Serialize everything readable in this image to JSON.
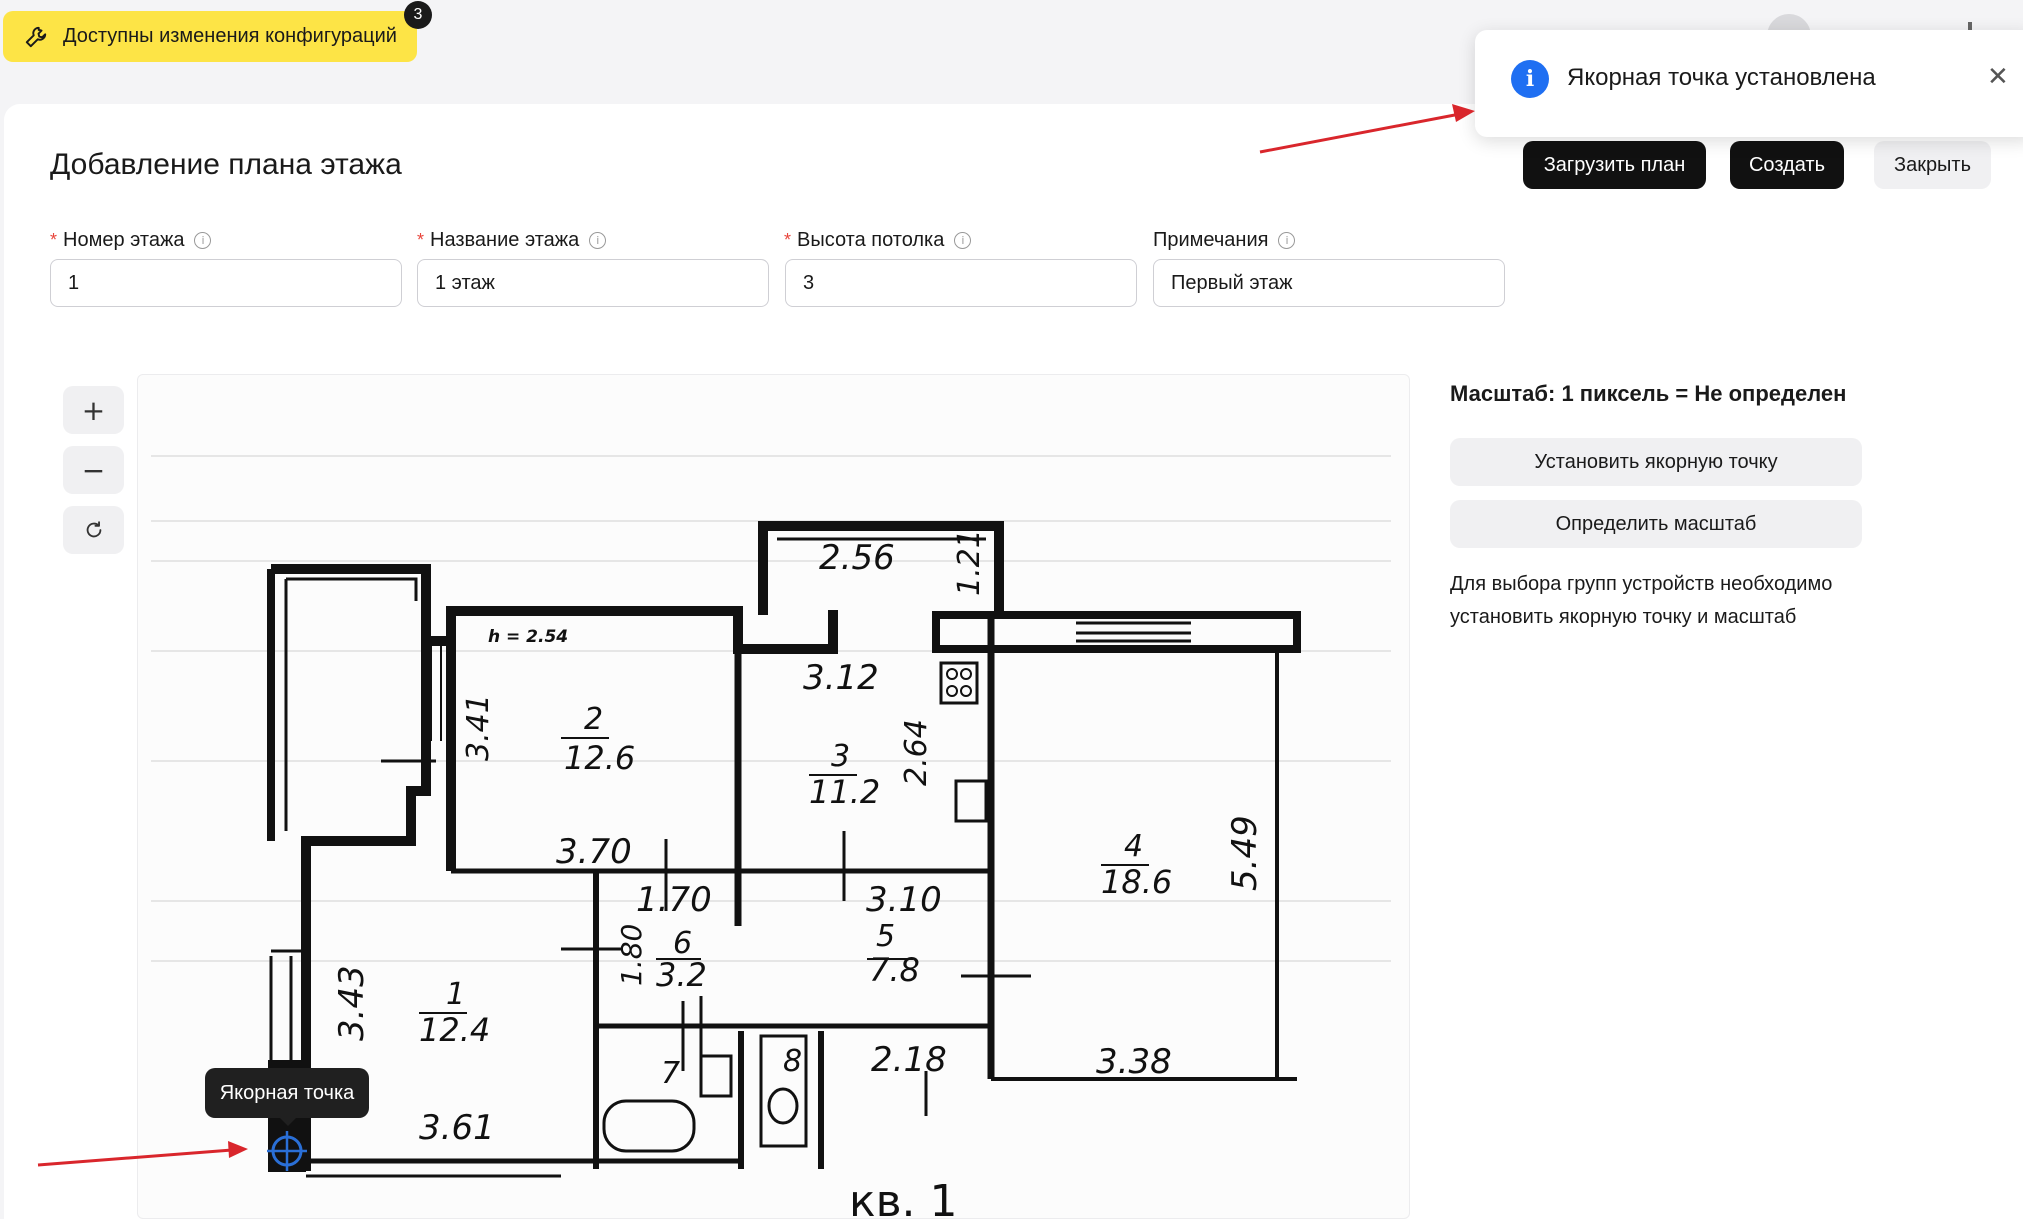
{
  "banner": {
    "label": "Доступны изменения конфигураций",
    "badge_count": "3",
    "icon": "wrench-icon"
  },
  "toast": {
    "icon": "info-icon",
    "message": "Якорная точка установлена",
    "close_icon": "close-icon"
  },
  "page": {
    "title": "Добавление плана этажа"
  },
  "header_buttons": {
    "upload": "Загрузить план",
    "create": "Создать",
    "close": "Закрыть"
  },
  "form": {
    "floor_number": {
      "label": "Номер этажа",
      "value": "1",
      "required": true
    },
    "floor_name": {
      "label": "Название этажа",
      "value": "1 этаж",
      "required": true
    },
    "ceiling_height": {
      "label": "Высота потолка",
      "value": "3",
      "required": true
    },
    "notes": {
      "label": "Примечания",
      "value": "Первый этаж",
      "required": false
    }
  },
  "zoom": {
    "in": "+",
    "out": "−",
    "reset": "reset-icon"
  },
  "side_panel": {
    "scale": "Масштаб: 1 пиксель = Не определен",
    "set_anchor": "Установить якорную точку",
    "define_scale": "Определить масштаб",
    "hint": "Для выбора групп устройств необходимо установить якорную точку и масштаб"
  },
  "anchor_tooltip": "Якорная точка",
  "plan": {
    "rooms": [
      {
        "number": "1",
        "area": "12.4"
      },
      {
        "number": "2",
        "area": "12.6"
      },
      {
        "number": "3",
        "area": "11.2"
      },
      {
        "number": "4",
        "area": "18.6"
      },
      {
        "number": "5",
        "area": "7.8"
      },
      {
        "number": "6",
        "area": "3.2"
      },
      {
        "number": "7",
        "area": ""
      },
      {
        "number": "8",
        "area": ""
      }
    ],
    "dimensions": [
      "2.56",
      "1.21",
      "3.12",
      "2.64",
      "3.41",
      "3.70",
      "1.70",
      "3.10",
      "5.49",
      "1.80",
      "3.43",
      "2.18",
      "3.38",
      "3.61"
    ],
    "height_note": "h = 2.54",
    "caption": "кв. 1"
  },
  "colors": {
    "accent_yellow": "#fde446",
    "primary_dark": "#111111",
    "info_blue": "#1f6ff2",
    "arrow_red": "#d9262c",
    "anchor_blue": "#2a6fd6"
  }
}
